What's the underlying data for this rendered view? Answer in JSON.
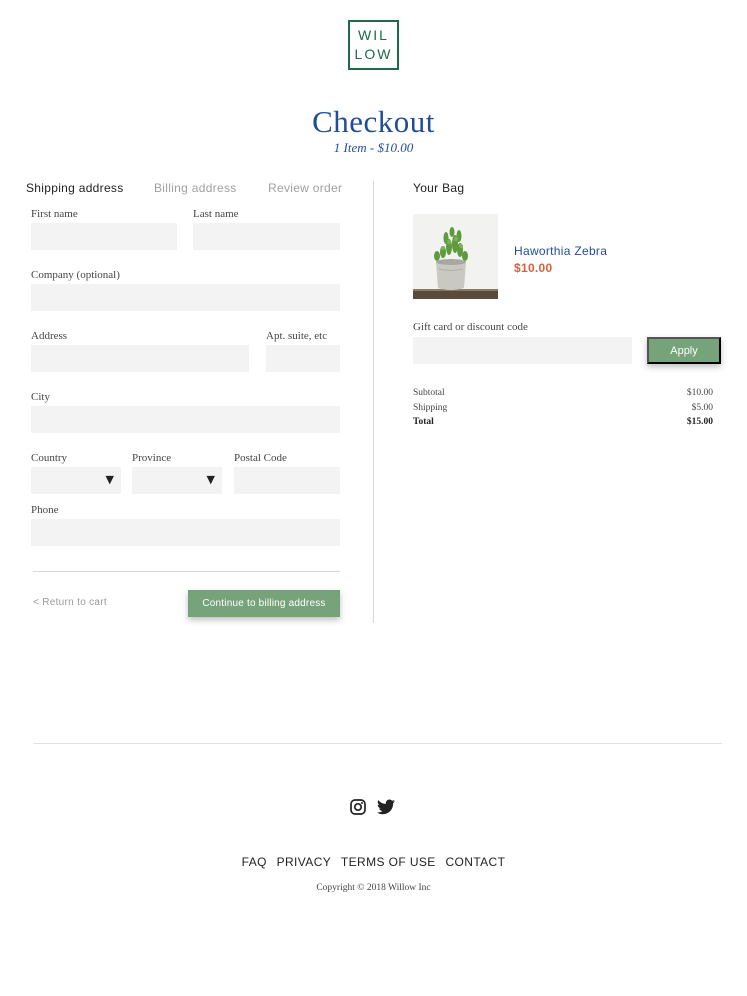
{
  "brand": {
    "logo_line1": "WIL",
    "logo_line2": "LOW"
  },
  "header": {
    "title": "Checkout",
    "subtitle": "1 Item - $10.00"
  },
  "steps": [
    {
      "label": "Shipping address",
      "state": "active"
    },
    {
      "label": "Billing address",
      "state": "inactive"
    },
    {
      "label": "Review order",
      "state": "inactive"
    }
  ],
  "form": {
    "first_name_label": "First name",
    "last_name_label": "Last name",
    "company_label": "Company (optional)",
    "address_label": "Address",
    "apt_label": "Apt. suite, etc",
    "city_label": "City",
    "country_label": "Country",
    "province_label": "Province",
    "postal_label": "Postal Code",
    "phone_label": "Phone",
    "return_link": "< Return to cart",
    "continue_button": "Continue to billing address"
  },
  "bag": {
    "title": "Your Bag",
    "product_name": "Haworthia Zebra",
    "product_price": "$10.00",
    "gift_label": "Gift card or discount code",
    "apply_button": "Apply",
    "summary": {
      "subtotal_label": "Subtotal",
      "subtotal_value": "$10.00",
      "shipping_label": "Shipping",
      "shipping_value": "$5.00",
      "total_label": "Total",
      "total_value": "$15.00"
    }
  },
  "footer": {
    "links": [
      "FAQ",
      "PRIVACY",
      "TERMS OF USE",
      "CONTACT"
    ],
    "copyright": "Copyright © 2018 Willow Inc"
  },
  "colors": {
    "brand_green": "#1e6a4a",
    "button_green": "#76a37a",
    "title_blue": "#1f4d9a",
    "price_orange": "#d9603b"
  }
}
